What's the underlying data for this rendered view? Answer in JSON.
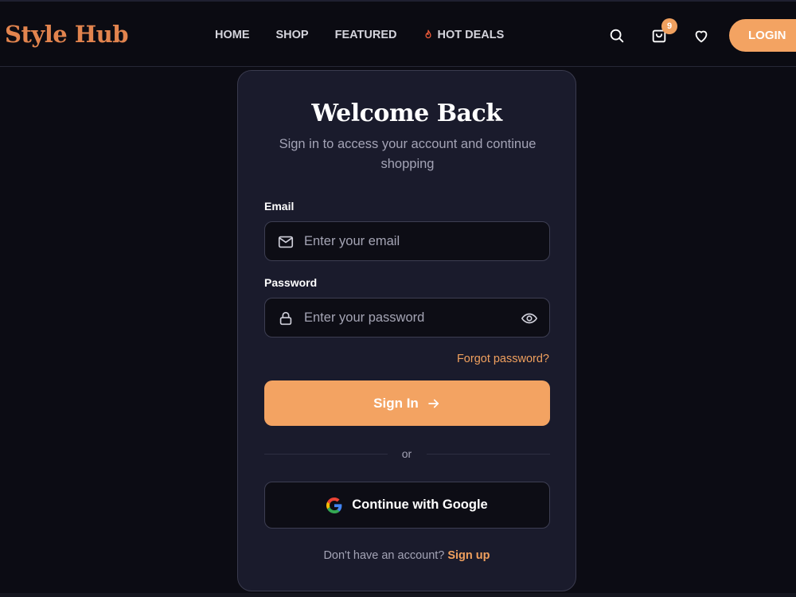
{
  "brand": {
    "name": "Style Hub"
  },
  "nav": {
    "links": [
      "HOME",
      "SHOP",
      "FEATURED",
      "HOT DEALS"
    ],
    "cart_count": "9",
    "login_label": "LOGIN"
  },
  "icons": {
    "search": "search-icon",
    "cart": "shopping-bag-icon",
    "wishlist": "heart-icon",
    "hot": "fire-icon",
    "email": "mail-icon",
    "password": "lock-icon",
    "toggle": "eye-icon",
    "submit": "arrow-right-icon",
    "google": "google-g-icon"
  },
  "colors": {
    "accent": "#f3a362",
    "brand": "#e2844e",
    "background": "#0c0c14",
    "card": "#1a1b2c"
  },
  "login_card": {
    "title": "Welcome Back",
    "subtitle": "Sign in to access your account and continue shopping",
    "email_label": "Email",
    "email_placeholder": "Enter your email",
    "email_value": "",
    "password_label": "Password",
    "password_placeholder": "Enter your password",
    "password_value": "",
    "forgot_label": "Forgot password?",
    "signin_label": "Sign In",
    "divider_text": "or",
    "google_label": "Continue with Google",
    "signup_prompt": "Don't have an account?",
    "signup_link": "Sign up"
  }
}
